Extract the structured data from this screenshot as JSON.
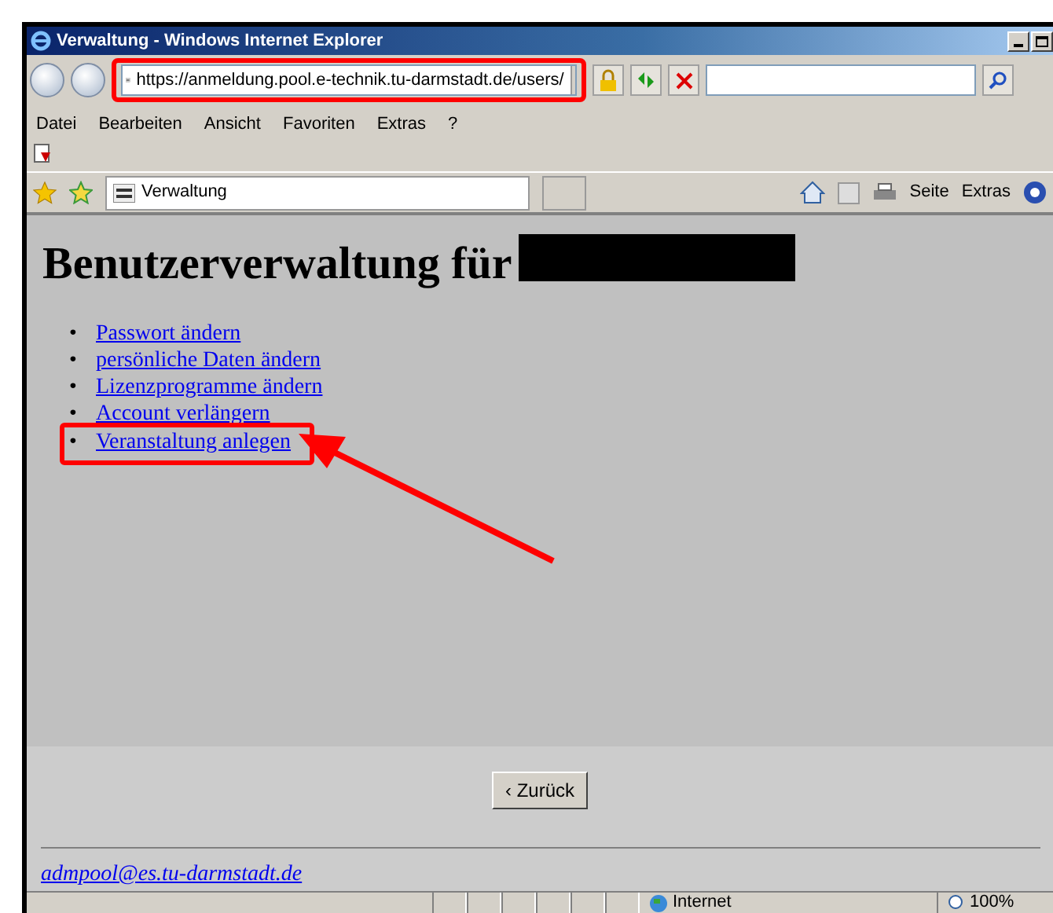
{
  "window": {
    "title": "Verwaltung - Windows Internet Explorer"
  },
  "address_bar": {
    "url": "https://anmeldung.pool.e-technik.tu-darmstadt.de/users/",
    "highlighted": true
  },
  "menu": [
    "Datei",
    "Bearbeiten",
    "Ansicht",
    "Favoriten",
    "Extras",
    "?"
  ],
  "tab": {
    "label": "Verwaltung"
  },
  "command_bar": [
    "Seite",
    "Extras"
  ],
  "page": {
    "heading": "Benutzerverwaltung für",
    "name_redacted": true,
    "links": [
      {
        "marker": "•",
        "label": "Passwort ändern",
        "highlighted": false
      },
      {
        "marker": "•",
        "label": "persönliche Daten ändern",
        "highlighted": false
      },
      {
        "marker": "•",
        "label": "Lizenzprogramme ändern",
        "highlighted": false
      },
      {
        "marker": "•",
        "label": "Account verlängern",
        "highlighted": false
      },
      {
        "marker": "•",
        "label": "Veranstaltung anlegen",
        "highlighted": true
      }
    ],
    "back_button": "‹ Zurück",
    "footer_email": "admpool@es.tu-darmstadt.de"
  },
  "status_bar": {
    "zone": "Internet",
    "zoom": "100%"
  }
}
